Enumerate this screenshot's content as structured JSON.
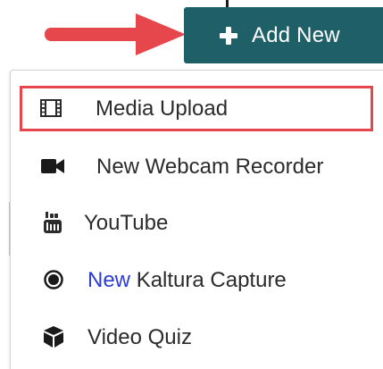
{
  "toolbar": {
    "add_new_label": "Add New"
  },
  "menu": {
    "items": [
      {
        "label": "Media Upload",
        "icon": "film-icon",
        "highlighted": true
      },
      {
        "label": "New Webcam Recorder",
        "icon": "video-camera-icon"
      },
      {
        "label": "YouTube",
        "icon": "youtube-icon"
      },
      {
        "new_badge": "New",
        "label": "Kaltura Capture",
        "icon": "record-icon"
      },
      {
        "label": "Video Quiz",
        "icon": "cube-icon"
      }
    ]
  },
  "colors": {
    "button_bg": "#1f5f67",
    "annotation_red": "#e5474c",
    "new_badge": "#2a3bd6"
  }
}
